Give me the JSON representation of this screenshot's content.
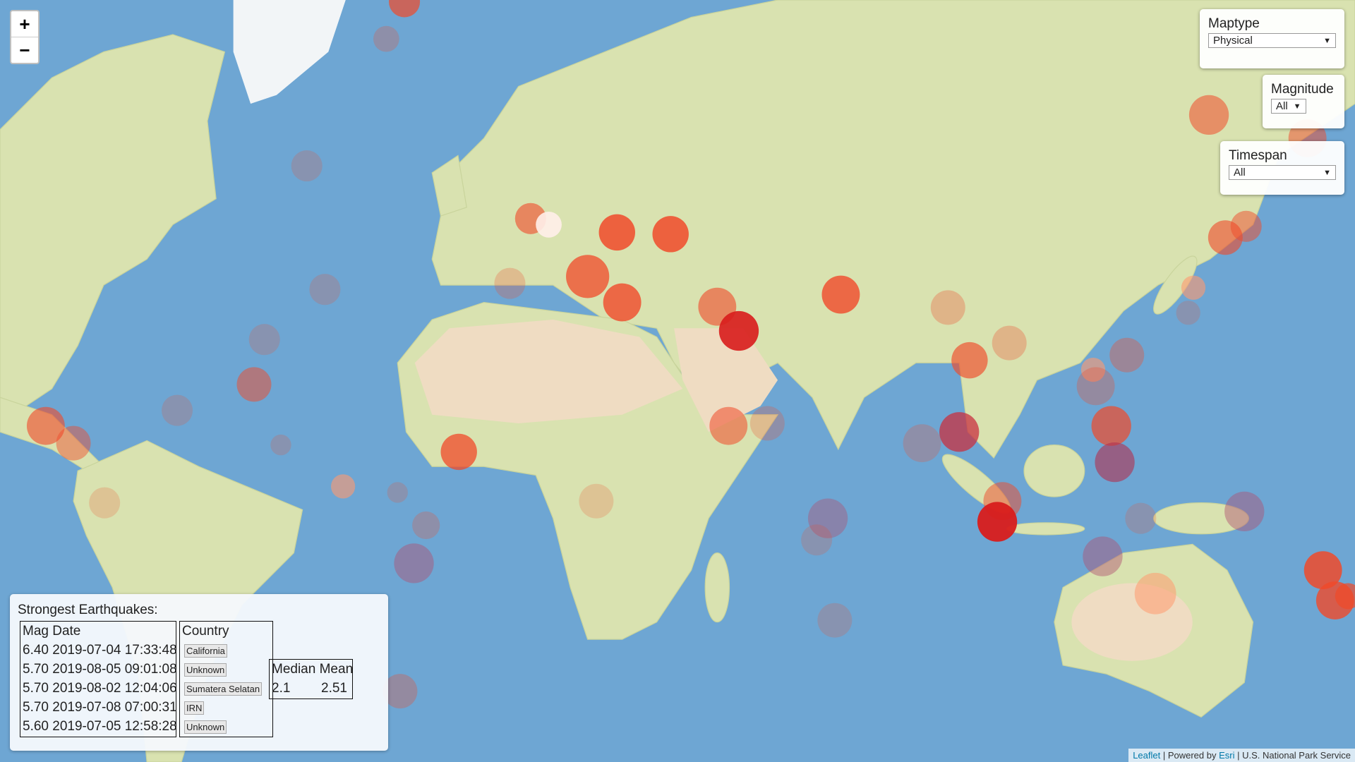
{
  "map": {
    "colors": {
      "ocean": "#6ea6d3",
      "land": "#d9e2b0",
      "desert": "#efdcc2",
      "ice": "#f2f5f7",
      "quake": "#f04a2a"
    },
    "earthquakes": [
      {
        "pos": [
          468,
          2
        ],
        "r": 18,
        "o": 0.7
      },
      {
        "pos": [
          447,
          45
        ],
        "r": 15,
        "o": 0.25
      },
      {
        "pos": [
          355,
          192
        ],
        "r": 18,
        "o": 0.2
      },
      {
        "pos": [
          376,
          335
        ],
        "r": 18,
        "o": 0.2
      },
      {
        "pos": [
          306,
          393
        ],
        "r": 18,
        "o": 0.2
      },
      {
        "pos": [
          294,
          445
        ],
        "r": 20,
        "o": 0.5
      },
      {
        "pos": [
          205,
          475
        ],
        "r": 18,
        "o": 0.2
      },
      {
        "pos": [
          53,
          493
        ],
        "r": 22,
        "o": 0.6
      },
      {
        "pos": [
          85,
          513
        ],
        "r": 20,
        "o": 0.45
      },
      {
        "pos": [
          325,
          515
        ],
        "r": 12,
        "o": 0.2
      },
      {
        "pos": [
          397,
          563
        ],
        "r": 14,
        "o": 0.6,
        "c": "#ff9a70"
      },
      {
        "pos": [
          121,
          582
        ],
        "r": 18,
        "o": 0.2
      },
      {
        "pos": [
          460,
          570
        ],
        "r": 12,
        "o": 0.2
      },
      {
        "pos": [
          493,
          608
        ],
        "r": 16,
        "o": 0.25
      },
      {
        "pos": [
          479,
          652
        ],
        "r": 23,
        "o": 0.45,
        "c": "#b05070"
      },
      {
        "pos": [
          463,
          800
        ],
        "r": 20,
        "o": 0.3
      },
      {
        "pos": [
          531,
          523
        ],
        "r": 21,
        "o": 0.75
      },
      {
        "pos": [
          614,
          253
        ],
        "r": 18,
        "o": 0.6
      },
      {
        "pos": [
          635,
          260
        ],
        "r": 15,
        "o": 0.9,
        "c": "#fff0ea"
      },
      {
        "pos": [
          680,
          320
        ],
        "r": 25,
        "o": 0.75
      },
      {
        "pos": [
          720,
          350
        ],
        "r": 22,
        "o": 0.8
      },
      {
        "pos": [
          714,
          269
        ],
        "r": 21,
        "o": 0.85
      },
      {
        "pos": [
          776,
          271
        ],
        "r": 21,
        "o": 0.85
      },
      {
        "pos": [
          590,
          328
        ],
        "r": 18,
        "o": 0.25
      },
      {
        "pos": [
          830,
          355
        ],
        "r": 22,
        "o": 0.6
      },
      {
        "pos": [
          855,
          383
        ],
        "r": 23,
        "o": 0.9,
        "c": "#d81c1c"
      },
      {
        "pos": [
          843,
          493
        ],
        "r": 22,
        "o": 0.55
      },
      {
        "pos": [
          888,
          490
        ],
        "r": 20,
        "o": 0.25
      },
      {
        "pos": [
          690,
          580
        ],
        "r": 20,
        "o": 0.2
      },
      {
        "pos": [
          973,
          341
        ],
        "r": 22,
        "o": 0.8
      },
      {
        "pos": [
          958,
          600
        ],
        "r": 23,
        "o": 0.4,
        "c": "#b05070"
      },
      {
        "pos": [
          945,
          625
        ],
        "r": 18,
        "o": 0.2
      },
      {
        "pos": [
          966,
          718
        ],
        "r": 20,
        "o": 0.2
      },
      {
        "pos": [
          1067,
          513
        ],
        "r": 22,
        "o": 0.25
      },
      {
        "pos": [
          1110,
          500
        ],
        "r": 23,
        "o": 0.75,
        "c": "#c83040"
      },
      {
        "pos": [
          1097,
          356
        ],
        "r": 20,
        "o": 0.3
      },
      {
        "pos": [
          1122,
          417
        ],
        "r": 21,
        "o": 0.65
      },
      {
        "pos": [
          1168,
          397
        ],
        "r": 20,
        "o": 0.3
      },
      {
        "pos": [
          1160,
          580
        ],
        "r": 22,
        "o": 0.5
      },
      {
        "pos": [
          1154,
          604
        ],
        "r": 23,
        "o": 0.95,
        "c": "#d81c1c"
      },
      {
        "pos": [
          1265,
          428
        ],
        "r": 14,
        "o": 0.6,
        "c": "#ff9a70"
      },
      {
        "pos": [
          1268,
          447
        ],
        "r": 22,
        "o": 0.3
      },
      {
        "pos": [
          1286,
          493
        ],
        "r": 23,
        "o": 0.7
      },
      {
        "pos": [
          1290,
          535
        ],
        "r": 23,
        "o": 0.6,
        "c": "#b03050"
      },
      {
        "pos": [
          1304,
          411
        ],
        "r": 20,
        "o": 0.35
      },
      {
        "pos": [
          1276,
          644
        ],
        "r": 23,
        "o": 0.45,
        "c": "#b05070"
      },
      {
        "pos": [
          1320,
          600
        ],
        "r": 18,
        "o": 0.2
      },
      {
        "pos": [
          1337,
          687
        ],
        "r": 24,
        "o": 0.55,
        "c": "#ff9a70"
      },
      {
        "pos": [
          1440,
          592
        ],
        "r": 23,
        "o": 0.45,
        "c": "#b05070"
      },
      {
        "pos": [
          1399,
          133
        ],
        "r": 23,
        "o": 0.55
      },
      {
        "pos": [
          1513,
          160
        ],
        "r": 22,
        "o": 0.5
      },
      {
        "pos": [
          1418,
          275
        ],
        "r": 20,
        "o": 0.6
      },
      {
        "pos": [
          1442,
          262
        ],
        "r": 18,
        "o": 0.5
      },
      {
        "pos": [
          1381,
          333
        ],
        "r": 14,
        "o": 0.6,
        "c": "#ff9a70"
      },
      {
        "pos": [
          1375,
          362
        ],
        "r": 14,
        "o": 0.2
      },
      {
        "pos": [
          1531,
          660
        ],
        "r": 22,
        "o": 0.85
      },
      {
        "pos": [
          1545,
          695
        ],
        "r": 22,
        "o": 0.8
      },
      {
        "pos": [
          1560,
          690
        ],
        "r": 15,
        "o": 0.7
      }
    ]
  },
  "zoom": {
    "in": "+",
    "out": "−"
  },
  "controls": {
    "maptype": {
      "label": "Maptype",
      "value": "Physical"
    },
    "magnitude": {
      "label": "Magnitude",
      "value": "All"
    },
    "timespan": {
      "label": "Timespan",
      "value": "All"
    },
    "arrow": "▼"
  },
  "legend": {
    "title": "Strongest Earthquakes:",
    "table_header": "Mag Date",
    "rows": [
      "6.40 2019-07-04 17:33:48",
      "5.70 2019-08-05 09:01:08",
      "5.70 2019-08-02 12:04:06",
      "5.70 2019-07-08 07:00:31",
      "5.60 2019-07-05 12:58:28"
    ],
    "country_header": "Country",
    "countries": [
      "California",
      "Unknown",
      "Sumatera Selatan",
      "IRN",
      "Unknown"
    ],
    "stats": {
      "median_label": "Median",
      "mean_label": "Mean",
      "median": "2.1",
      "mean": "2.51"
    }
  },
  "attribution": {
    "leaflet": "Leaflet",
    "sep1": " | Powered by ",
    "esri": "Esri",
    "sep2": " | U.S. National Park Service"
  }
}
